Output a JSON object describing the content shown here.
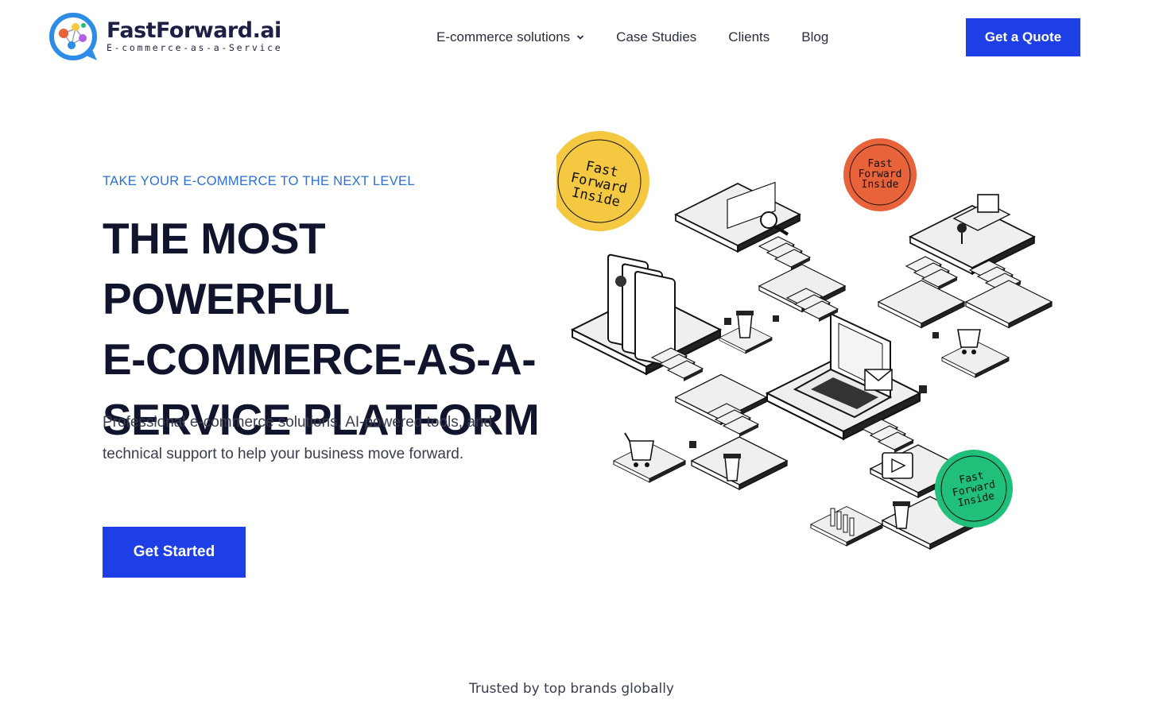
{
  "brand": {
    "name": "FastForward.ai",
    "tagline": "E-commerce-as-a-Service",
    "colors": {
      "primary": "#1f3fe6",
      "eyebrow": "#2c6fd6",
      "heading": "#11142d"
    }
  },
  "nav": {
    "items": [
      {
        "label": "E-commerce solutions",
        "has_dropdown": true
      },
      {
        "label": "Case Studies"
      },
      {
        "label": "Clients"
      },
      {
        "label": "Blog"
      }
    ],
    "cta_label": "Get a Quote"
  },
  "hero": {
    "eyebrow": "TAKE YOUR E-COMMERCE TO THE NEXT LEVEL",
    "headline_lines": [
      "THE MOST POWERFUL",
      "E-COMMERCE-AS-A-",
      "SERVICE PLATFORM"
    ],
    "subtitle_lines": [
      "Professional e-commerce solutions, AI-powered tools, and",
      "technical support to help your business move forward."
    ],
    "cta_label": "Get Started"
  },
  "badges": [
    {
      "text": [
        "Fast",
        "Forward",
        "Inside"
      ],
      "color": "#f5c842"
    },
    {
      "text": [
        "Fast",
        "Forward",
        "Inside"
      ],
      "color": "#e8623a"
    },
    {
      "text": [
        "Fast",
        "Forward",
        "Inside"
      ],
      "color": "#20c07a"
    }
  ],
  "trusted_text": "Trusted by top brands globally"
}
